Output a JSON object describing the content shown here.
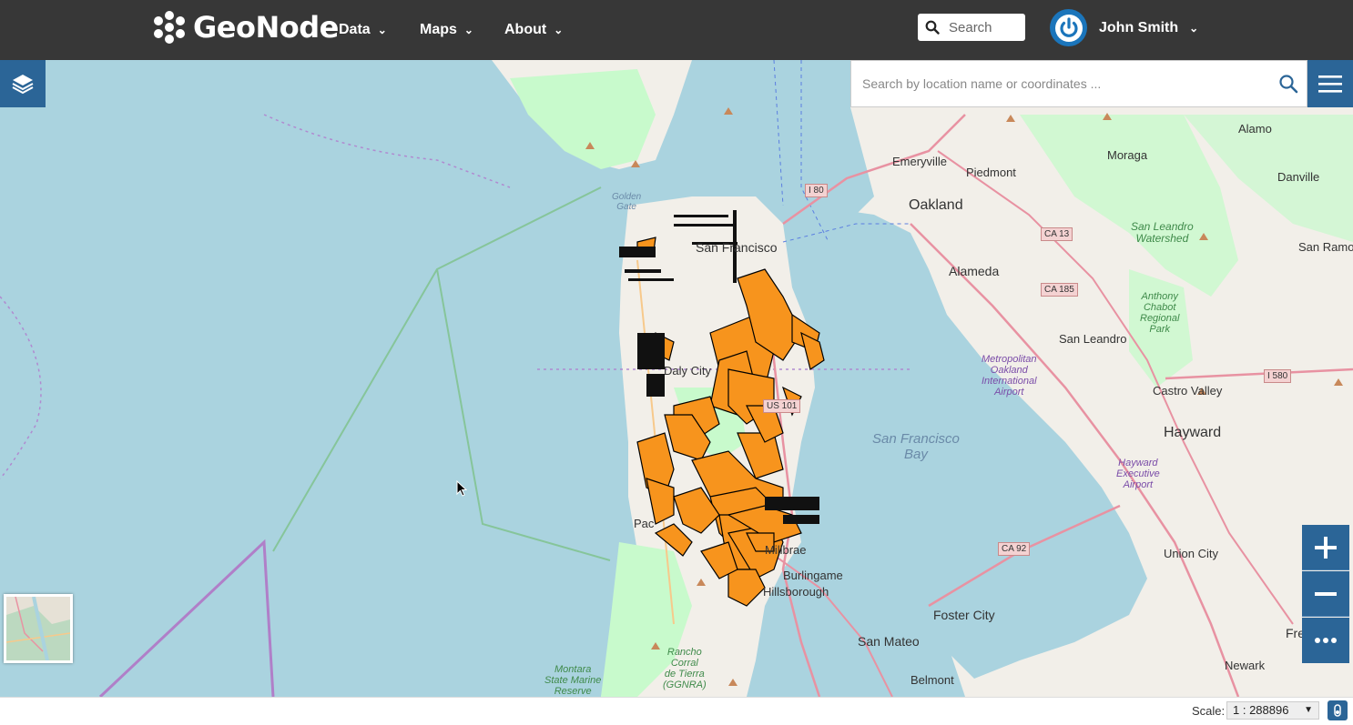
{
  "header": {
    "logo_text": "GeoNode",
    "nav": [
      {
        "label": "Data"
      },
      {
        "label": "Maps"
      },
      {
        "label": "About"
      }
    ],
    "search_placeholder": "Search",
    "user_name": "John Smith"
  },
  "map": {
    "location_search_placeholder": "Search by location name or coordinates ...",
    "labels": {
      "san_francisco": "San Francisco",
      "oakland": "Oakland",
      "alameda": "Alameda",
      "emeryville": "Emeryville",
      "piedmont": "Piedmont",
      "moraga": "Moraga",
      "alamo": "Alamo",
      "danville": "Danville",
      "san_ramon": "San Ramon",
      "san_leandro": "San Leandro",
      "castro_valley": "Castro Valley",
      "hayward": "Hayward",
      "union_city": "Union City",
      "newark": "Newark",
      "fre": "Fre",
      "foster_city": "Foster City",
      "san_mateo": "San Mateo",
      "belmont": "Belmont",
      "burlingame": "Burlingame",
      "hillsborough": "Hillsborough",
      "millbrae": "Millbrae",
      "daly_city": "Daly City",
      "pac": "Pac",
      "golden_gate": "Golden\nGate",
      "sf_bay": "San Francisco\nBay",
      "sl_watershed": "San Leandro\nWatershed",
      "anthony_chabot": "Anthony\nChabot\nRegional\nPark",
      "oakland_airport": "Metropolitan\nOakland\nInternational\nAirport",
      "hayward_airport": "Hayward\nExecutive\nAirport",
      "rancho_corral": "Rancho\nCorral\nde Tierra\n(GGNRA)",
      "montara": "Montara\nState Marine\nReserve"
    },
    "shields": [
      "I 80",
      "CA 13",
      "CA 185",
      "US 101",
      "I 580",
      "CA 92"
    ],
    "layer_fill_color": "#f7941d"
  },
  "footer": {
    "scale_label": "Scale:",
    "scale_value": "1 : 288896"
  },
  "colors": {
    "header_bg": "#373737",
    "control_blue": "#2b6597",
    "water": "#aad3df",
    "land": "#f2efe9",
    "park": "#c8facc"
  }
}
